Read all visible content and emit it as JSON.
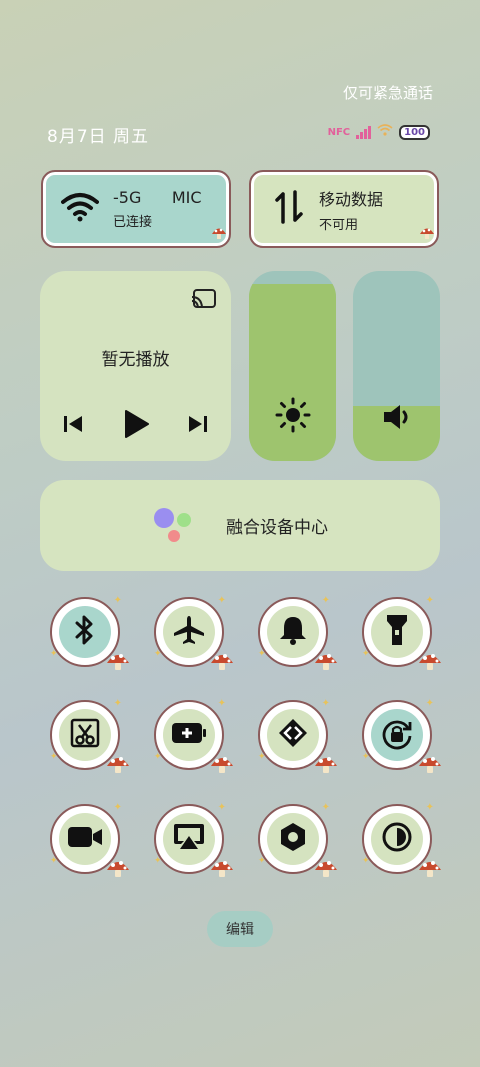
{
  "status_bar": {
    "emergency_text": "仅可紧急通话",
    "date_text": "8月7日 周五",
    "nfc_label": "NFC",
    "battery_level": "100"
  },
  "wifi_tile": {
    "network": "-5G",
    "network_extra": "MIC",
    "status": "已连接"
  },
  "data_tile": {
    "title": "移动数据",
    "status": "不可用"
  },
  "media": {
    "title": "暂无播放"
  },
  "brightness": {
    "level_percent": 93
  },
  "volume": {
    "level_percent": 29
  },
  "device_center": {
    "label": "融合设备中心"
  },
  "toggles": [
    {
      "name": "bluetooth",
      "active": true
    },
    {
      "name": "airplane-mode",
      "active": false
    },
    {
      "name": "ringer",
      "active": false
    },
    {
      "name": "flashlight",
      "active": false
    },
    {
      "name": "screenshot-scissors",
      "active": false
    },
    {
      "name": "battery-saver",
      "active": false
    },
    {
      "name": "nearby-share",
      "active": false
    },
    {
      "name": "rotation-lock",
      "active": true
    },
    {
      "name": "screen-record",
      "active": false
    },
    {
      "name": "screen-cast",
      "active": false
    },
    {
      "name": "settings-nut",
      "active": false
    },
    {
      "name": "dark-mode",
      "active": false
    }
  ],
  "edit_button": "编辑"
}
